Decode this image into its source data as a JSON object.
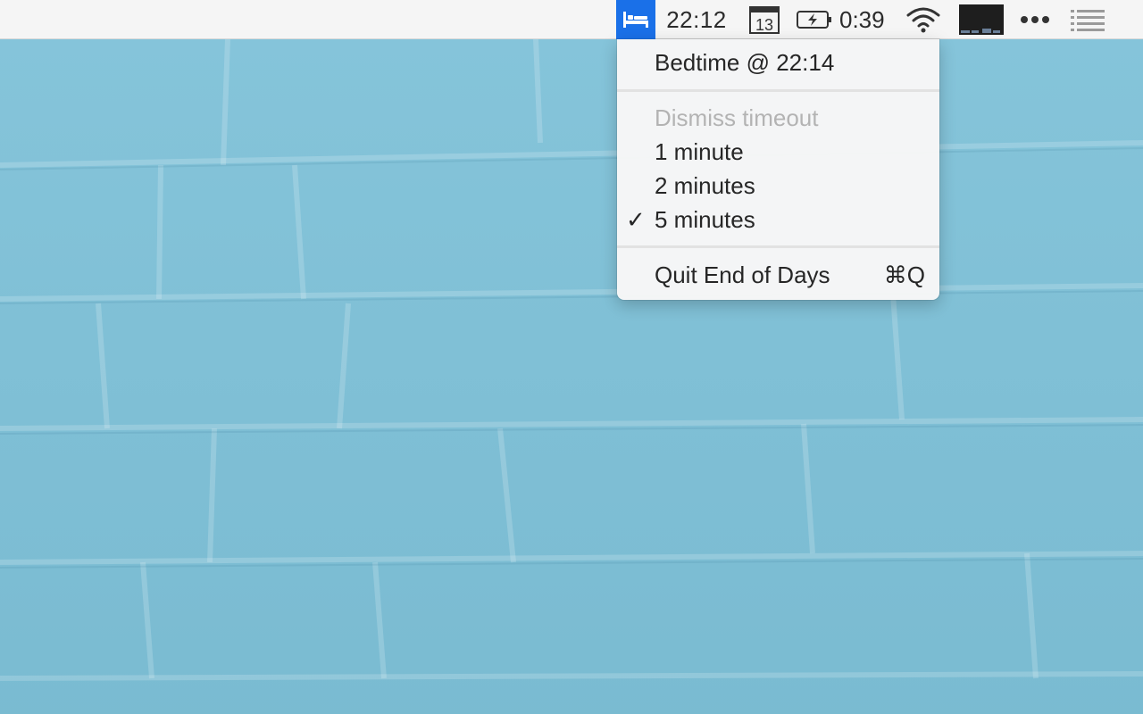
{
  "menubar": {
    "clock": "22:12",
    "calendar_day": "13",
    "battery_time": "0:39",
    "app_icon": "bed-icon",
    "icons": [
      "bed-icon",
      "calendar-icon",
      "battery-charging-icon",
      "wifi-icon",
      "display-icon",
      "more-icon",
      "list-icon"
    ]
  },
  "menu": {
    "bedtime": "Bedtime @ 22:14",
    "section_header": "Dismiss timeout",
    "options": [
      {
        "label": "1 minute",
        "checked": false
      },
      {
        "label": "2 minutes",
        "checked": false
      },
      {
        "label": "5 minutes",
        "checked": true
      }
    ],
    "checkmark": "✓",
    "quit_label": "Quit End of Days",
    "quit_shortcut": "⌘Q"
  },
  "colors": {
    "app_icon_bg": "#1a70e8",
    "wallpaper": "#7ec1d8",
    "menubar_bg": "#f5f5f5"
  }
}
